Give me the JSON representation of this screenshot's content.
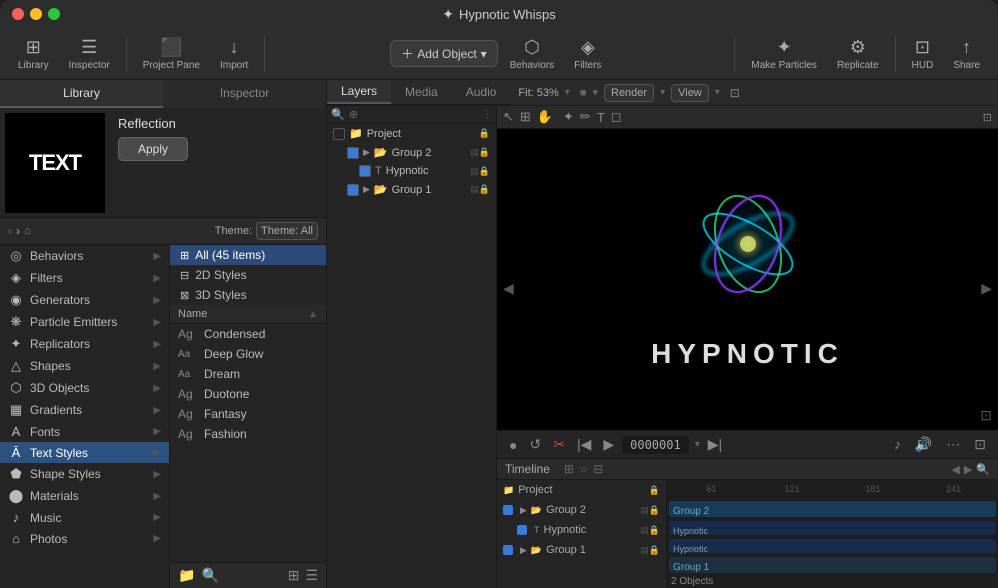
{
  "app": {
    "title": "Hypnotic Whisps",
    "icon": "✦"
  },
  "titlebar": {
    "traffic_lights": [
      "red",
      "yellow",
      "green"
    ]
  },
  "toolbar": {
    "library_label": "Library",
    "inspector_label": "Inspector",
    "project_pane_label": "Project Pane",
    "import_label": "Import",
    "add_object_label": "Add Object",
    "behaviors_label": "Behaviors",
    "filters_label": "Filters",
    "make_particles_label": "Make Particles",
    "replicate_label": "Replicate",
    "hud_label": "HUD",
    "share_label": "Share"
  },
  "inspector": {
    "preview_text": "TEXT",
    "title": "Reflection",
    "apply_label": "Apply"
  },
  "library": {
    "panel_label": "Library",
    "inspector_label": "Inspector",
    "theme_label": "Theme: All",
    "categories": [
      {
        "icon": "◎",
        "label": "Behaviors"
      },
      {
        "icon": "◈",
        "label": "Filters"
      },
      {
        "icon": "◉",
        "label": "Generators"
      },
      {
        "icon": "❋",
        "label": "Particle Emitters"
      },
      {
        "icon": "✦",
        "label": "Replicators"
      },
      {
        "icon": "△",
        "label": "Shapes"
      },
      {
        "icon": "⬡",
        "label": "3D Objects"
      },
      {
        "icon": "▦",
        "label": "Gradients"
      },
      {
        "icon": "A",
        "label": "Fonts"
      },
      {
        "icon": "Ā",
        "label": "Text Styles"
      },
      {
        "icon": "⬟",
        "label": "Shape Styles"
      },
      {
        "icon": "⬤",
        "label": "Materials"
      },
      {
        "icon": "♪",
        "label": "Music"
      },
      {
        "icon": "⌂",
        "label": "Photos"
      }
    ],
    "subcategories": [
      {
        "label": "All (45 items)",
        "selected": true
      },
      {
        "label": "2D Styles"
      },
      {
        "label": "3D Styles"
      }
    ],
    "name_header": "Name",
    "name_items": [
      {
        "icon": "Ag",
        "label": "Condensed"
      },
      {
        "icon": "Aa",
        "label": "Deep Glow"
      },
      {
        "icon": "Aa",
        "label": "Dream"
      },
      {
        "icon": "Ag",
        "label": "Duotone"
      },
      {
        "icon": "Ag",
        "label": "Fantasy"
      },
      {
        "icon": "Ag",
        "label": "Fashion"
      }
    ]
  },
  "layers": {
    "tabs": [
      "Layers",
      "Media",
      "Audio"
    ],
    "active_tab": "Layers",
    "items": [
      {
        "label": "Project",
        "indent": 0,
        "checked": false,
        "icon": "📁"
      },
      {
        "label": "Group 2",
        "indent": 1,
        "checked": true,
        "icon": "📂"
      },
      {
        "label": "Hypnotic",
        "indent": 2,
        "checked": true,
        "icon": "T"
      },
      {
        "label": "Group 1",
        "indent": 1,
        "checked": true,
        "icon": "📂"
      }
    ]
  },
  "canvas": {
    "fit_label": "Fit: 53%",
    "render_label": "Render",
    "view_label": "View",
    "hypnotic_label": "HYPNOTIC"
  },
  "timeline": {
    "label": "Timeline",
    "tracks": [
      {
        "label": "Project"
      },
      {
        "label": "Group 2"
      },
      {
        "label": "Hypnotic"
      },
      {
        "label": "Group 1"
      }
    ],
    "ruler_marks": [
      "61",
      "121",
      "181",
      "241"
    ],
    "right_labels": [
      {
        "type": "group",
        "label": "Group 2"
      },
      {
        "type": "item",
        "label": "Hypnotic"
      },
      {
        "type": "item",
        "label": "Hypnotic"
      },
      {
        "type": "group",
        "label": "Group 1"
      },
      {
        "type": "objects",
        "label": "2 Objects"
      }
    ]
  },
  "transport": {
    "timecode": "0000001"
  }
}
